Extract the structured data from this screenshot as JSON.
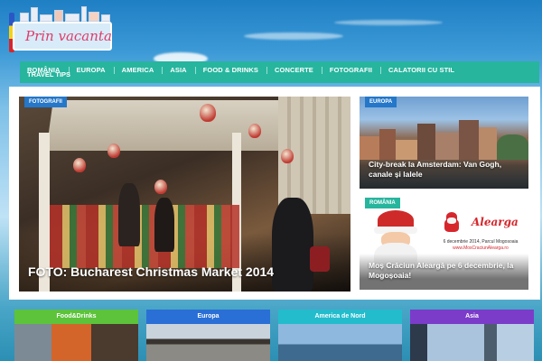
{
  "site": {
    "logo_text": "Prin vacanta"
  },
  "nav": {
    "items": [
      "ROMÂNIA",
      "EUROPA",
      "AMERICA",
      "ASIA",
      "FOOD & DRINKS",
      "CONCERTE",
      "FOTOGRAFII",
      "CALATORII CU STIL"
    ],
    "items_row2": [
      "TRAVEL TIPS"
    ],
    "color": "#27b59e"
  },
  "hero": {
    "badge": "FOTOGRAFII",
    "title": "FOTO: Bucharest Christmas Market 2014"
  },
  "side_articles": [
    {
      "badge": "EUROPA",
      "title": "City-break la Amsterdam: Van Gogh, canale și lalele"
    },
    {
      "badge": "ROMÂNIA",
      "title": "Moș Crăciun Aleargă pe 6 decembrie, la Mogoșoaia!",
      "ad_brand": "Alearga",
      "ad_line1": "6 decembrie 2014, Parcul Mogosoaia",
      "ad_line2": "www.MosCraciunAlearga.ro"
    }
  ],
  "categories": [
    {
      "label": "Food&Drinks",
      "color": "#5cc33a"
    },
    {
      "label": "Europa",
      "color": "#2a6fd6"
    },
    {
      "label": "America de Nord",
      "color": "#23bccd"
    },
    {
      "label": "Asia",
      "color": "#7b3cc9"
    }
  ],
  "colors": {
    "accent": "#27b59e",
    "badge_blue": "#2477c9"
  }
}
